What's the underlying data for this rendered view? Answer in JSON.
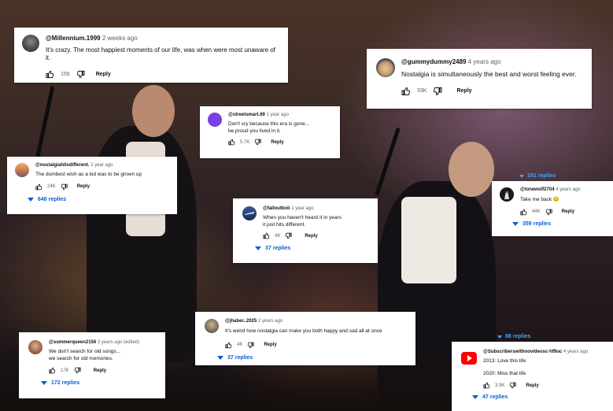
{
  "colors": {
    "link": "#065fd4",
    "text": "#0f0f0f",
    "muted": "#606060",
    "card_bg": "#ffffff",
    "youtube_red": "#ff0000"
  },
  "comments": [
    {
      "id": "millennium",
      "handle": "@Millennium.1999",
      "time": "2 weeks ago",
      "text": "It's crazy. The most happiest moments of our life, was when were most unaware of it.",
      "likes": "156",
      "reply": "Reply",
      "avatar_icon": "vintage-portrait-avatar"
    },
    {
      "id": "gummy",
      "handle": "@gummydummy2489",
      "time": "4 years ago",
      "text": "Nostalgia is simultaneously the best and worst feeling ever.",
      "likes": "33K",
      "reply": "Reply",
      "avatar_icon": "cartoon-face-avatar"
    },
    {
      "id": "streetsmart",
      "handle": "@streetsmart.69",
      "time": "1 year ago",
      "text_lines": [
        "Don't cry because this era is gone...",
        "be proud you lived in it."
      ],
      "likes": "5.7K",
      "reply": "Reply",
      "avatar_icon": "purple-circle-avatar"
    },
    {
      "id": "nostalgia",
      "handle": "@nostalgiahitsdifferent.",
      "time": "1 year ago",
      "text": "The dumbest wish as a kid was to be grown up",
      "likes": "24K",
      "reply": "Reply",
      "replies": "648 replies",
      "avatar_icon": "sunset-avatar"
    },
    {
      "id": "lonewolf",
      "handle": "@lonewolf2704",
      "time": "4 years ago",
      "text": "Take me back 😔",
      "likes": "44K",
      "reply": "Reply",
      "replies": "359 replies",
      "avatar_icon": "wolf-silhouette-avatar"
    },
    {
      "id": "fallout",
      "handle": "@falloutboii",
      "time": "1 year ago",
      "text_lines": [
        "When you haven't heard it in years",
        "it just hits different."
      ],
      "likes": "4K",
      "reply": "Reply",
      "replies": "37 replies",
      "avatar_icon": "plane-sky-avatar"
    },
    {
      "id": "jhaber",
      "handle": "@jhaber..2025",
      "time": "2 years ago",
      "text": "It's weird how nostalgia can make you both happy and sad all at once",
      "likes": "4K",
      "reply": "Reply",
      "replies": "37 replies",
      "avatar_icon": "person-photo-avatar"
    },
    {
      "id": "summer",
      "handle": "@summerqueen2156",
      "time": "2 years ago (edited)",
      "text_lines": [
        "We don't search for old songs...",
        "we search for old memories."
      ],
      "likes": "17K",
      "reply": "Reply",
      "replies": "172 replies",
      "avatar_icon": "woman-portrait-avatar"
    },
    {
      "id": "subscribers",
      "handle": "@Subscriberswithnovideosc-hf9uc",
      "time": "4 years ago",
      "text_lines": [
        "2013: Love this life",
        "2020: Miss that life"
      ],
      "likes": "3.9K",
      "reply": "Reply",
      "replies": "47 replies",
      "avatar_icon": "youtube-logo-avatar"
    }
  ],
  "fragment_links": {
    "f_161": "161 replies",
    "f_88": "88 replies"
  }
}
